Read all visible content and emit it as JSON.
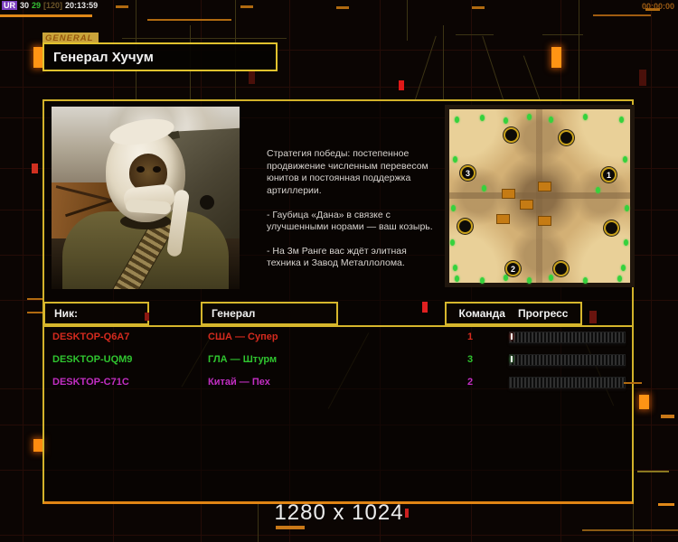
{
  "status_bar": {
    "gentool": {
      "tag": "UR",
      "value1": "30",
      "value2": "29",
      "bracket": "[120]",
      "clock": "20:13:59"
    },
    "match_timer": "00:00:00"
  },
  "general_panel": {
    "tab_label": "GENERAL",
    "title": "Генерал Хучум",
    "briefing": [
      "Стратегия победы: постепенное продвижение численным перевесом юнитов и постоянная поддержка артиллерии.",
      "- Гаубица «Дана» в связке с улучшенными норами — ваш козырь.",
      "- На 3м Ранге вас ждёт элитная техника и Завод Металлолома."
    ]
  },
  "map_preview": {
    "spawns": [
      {
        "label": ""
      },
      {
        "label": ""
      },
      {
        "label": "3"
      },
      {
        "label": "1"
      },
      {
        "label": ""
      },
      {
        "label": ""
      },
      {
        "label": "2"
      },
      {
        "label": ""
      }
    ]
  },
  "lobby_table": {
    "headers": {
      "nick": "Ник:",
      "general": "Генерал",
      "team": "Команда",
      "progress": "Прогресс"
    },
    "players": [
      {
        "nick": "DESKTOP-Q6A7",
        "general": "США — Супер",
        "team": "1",
        "color": "#d42a1e"
      },
      {
        "nick": "DESKTOP-UQM9",
        "general": "ГЛА — Штурм",
        "team": "3",
        "color": "#2fc42f"
      },
      {
        "nick": "DESKTOP-C71C",
        "general": "Китай — Пех",
        "team": "2",
        "color": "#c22ec2"
      }
    ]
  },
  "footer": {
    "resolution": "1280 x 1024"
  },
  "colors": {
    "accent_yellow": "#d2b22a",
    "accent_orange": "#e08414",
    "spawn_ring": "#caa21c",
    "supply_dot": "#35d23c"
  }
}
